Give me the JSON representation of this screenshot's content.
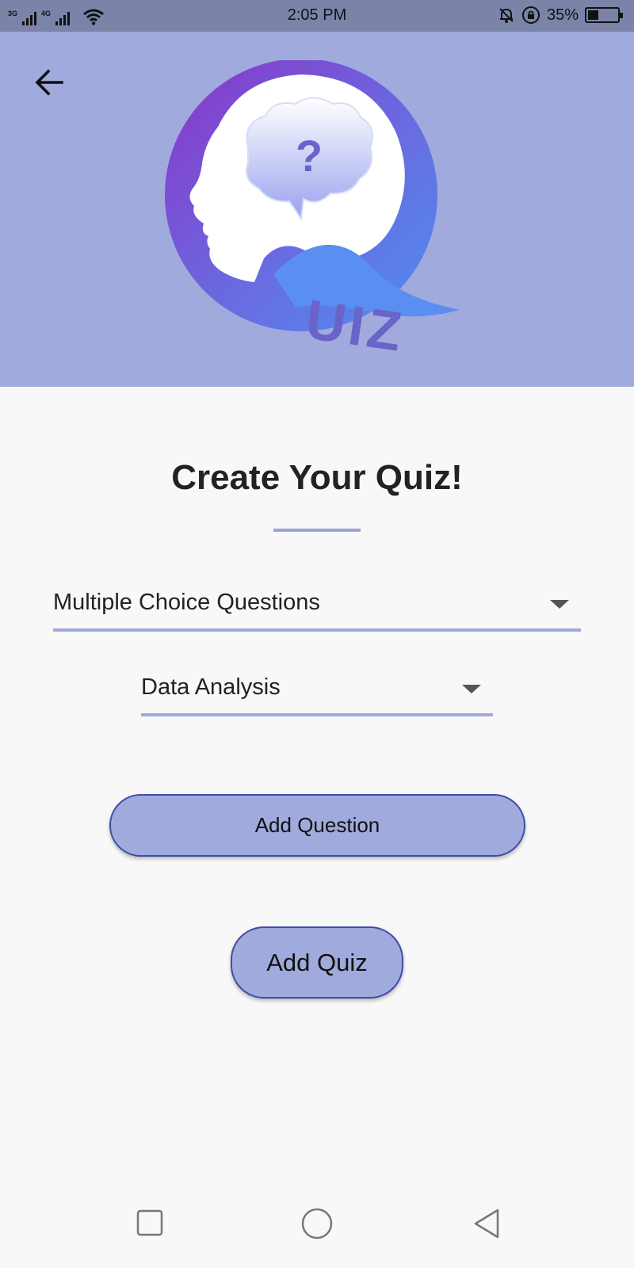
{
  "status_bar": {
    "network_3g": "3G",
    "network_4g": "4G",
    "time": "2:05 PM",
    "battery_percent": "35%",
    "battery_level": 0.35,
    "icons": [
      "signal-icon",
      "wifi-icon",
      "mute-icon",
      "rotation-lock-icon",
      "battery-icon"
    ]
  },
  "header": {
    "background_color": "#a0aadc",
    "back_icon": "back-arrow-icon",
    "logo": {
      "question_mark": "?",
      "wordmark": "UIZ"
    }
  },
  "main": {
    "title": "Create Your Quiz!",
    "question_type_dropdown": {
      "selected": "Multiple Choice Questions"
    },
    "category_dropdown": {
      "selected": "Data Analysis"
    },
    "add_question_label": "Add Question",
    "add_quiz_label": "Add Quiz"
  },
  "nav_bar": {
    "icons": [
      "recent-apps-icon",
      "home-icon",
      "back-icon"
    ]
  },
  "colors": {
    "accent": "#a0aadc",
    "button_border": "#3f4da8",
    "status_bar": "#7b84a8"
  }
}
